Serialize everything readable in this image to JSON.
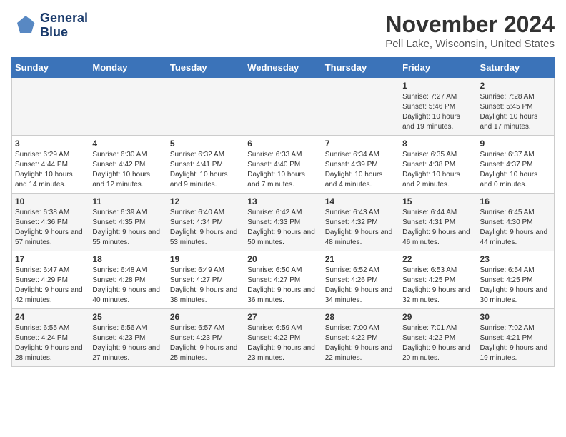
{
  "header": {
    "logo_line1": "General",
    "logo_line2": "Blue",
    "main_title": "November 2024",
    "subtitle": "Pell Lake, Wisconsin, United States"
  },
  "calendar": {
    "days_of_week": [
      "Sunday",
      "Monday",
      "Tuesday",
      "Wednesday",
      "Thursday",
      "Friday",
      "Saturday"
    ],
    "weeks": [
      [
        {
          "day": "",
          "info": ""
        },
        {
          "day": "",
          "info": ""
        },
        {
          "day": "",
          "info": ""
        },
        {
          "day": "",
          "info": ""
        },
        {
          "day": "",
          "info": ""
        },
        {
          "day": "1",
          "info": "Sunrise: 7:27 AM\nSunset: 5:46 PM\nDaylight: 10 hours and 19 minutes."
        },
        {
          "day": "2",
          "info": "Sunrise: 7:28 AM\nSunset: 5:45 PM\nDaylight: 10 hours and 17 minutes."
        }
      ],
      [
        {
          "day": "3",
          "info": "Sunrise: 6:29 AM\nSunset: 4:44 PM\nDaylight: 10 hours and 14 minutes."
        },
        {
          "day": "4",
          "info": "Sunrise: 6:30 AM\nSunset: 4:42 PM\nDaylight: 10 hours and 12 minutes."
        },
        {
          "day": "5",
          "info": "Sunrise: 6:32 AM\nSunset: 4:41 PM\nDaylight: 10 hours and 9 minutes."
        },
        {
          "day": "6",
          "info": "Sunrise: 6:33 AM\nSunset: 4:40 PM\nDaylight: 10 hours and 7 minutes."
        },
        {
          "day": "7",
          "info": "Sunrise: 6:34 AM\nSunset: 4:39 PM\nDaylight: 10 hours and 4 minutes."
        },
        {
          "day": "8",
          "info": "Sunrise: 6:35 AM\nSunset: 4:38 PM\nDaylight: 10 hours and 2 minutes."
        },
        {
          "day": "9",
          "info": "Sunrise: 6:37 AM\nSunset: 4:37 PM\nDaylight: 10 hours and 0 minutes."
        }
      ],
      [
        {
          "day": "10",
          "info": "Sunrise: 6:38 AM\nSunset: 4:36 PM\nDaylight: 9 hours and 57 minutes."
        },
        {
          "day": "11",
          "info": "Sunrise: 6:39 AM\nSunset: 4:35 PM\nDaylight: 9 hours and 55 minutes."
        },
        {
          "day": "12",
          "info": "Sunrise: 6:40 AM\nSunset: 4:34 PM\nDaylight: 9 hours and 53 minutes."
        },
        {
          "day": "13",
          "info": "Sunrise: 6:42 AM\nSunset: 4:33 PM\nDaylight: 9 hours and 50 minutes."
        },
        {
          "day": "14",
          "info": "Sunrise: 6:43 AM\nSunset: 4:32 PM\nDaylight: 9 hours and 48 minutes."
        },
        {
          "day": "15",
          "info": "Sunrise: 6:44 AM\nSunset: 4:31 PM\nDaylight: 9 hours and 46 minutes."
        },
        {
          "day": "16",
          "info": "Sunrise: 6:45 AM\nSunset: 4:30 PM\nDaylight: 9 hours and 44 minutes."
        }
      ],
      [
        {
          "day": "17",
          "info": "Sunrise: 6:47 AM\nSunset: 4:29 PM\nDaylight: 9 hours and 42 minutes."
        },
        {
          "day": "18",
          "info": "Sunrise: 6:48 AM\nSunset: 4:28 PM\nDaylight: 9 hours and 40 minutes."
        },
        {
          "day": "19",
          "info": "Sunrise: 6:49 AM\nSunset: 4:27 PM\nDaylight: 9 hours and 38 minutes."
        },
        {
          "day": "20",
          "info": "Sunrise: 6:50 AM\nSunset: 4:27 PM\nDaylight: 9 hours and 36 minutes."
        },
        {
          "day": "21",
          "info": "Sunrise: 6:52 AM\nSunset: 4:26 PM\nDaylight: 9 hours and 34 minutes."
        },
        {
          "day": "22",
          "info": "Sunrise: 6:53 AM\nSunset: 4:25 PM\nDaylight: 9 hours and 32 minutes."
        },
        {
          "day": "23",
          "info": "Sunrise: 6:54 AM\nSunset: 4:25 PM\nDaylight: 9 hours and 30 minutes."
        }
      ],
      [
        {
          "day": "24",
          "info": "Sunrise: 6:55 AM\nSunset: 4:24 PM\nDaylight: 9 hours and 28 minutes."
        },
        {
          "day": "25",
          "info": "Sunrise: 6:56 AM\nSunset: 4:23 PM\nDaylight: 9 hours and 27 minutes."
        },
        {
          "day": "26",
          "info": "Sunrise: 6:57 AM\nSunset: 4:23 PM\nDaylight: 9 hours and 25 minutes."
        },
        {
          "day": "27",
          "info": "Sunrise: 6:59 AM\nSunset: 4:22 PM\nDaylight: 9 hours and 23 minutes."
        },
        {
          "day": "28",
          "info": "Sunrise: 7:00 AM\nSunset: 4:22 PM\nDaylight: 9 hours and 22 minutes."
        },
        {
          "day": "29",
          "info": "Sunrise: 7:01 AM\nSunset: 4:22 PM\nDaylight: 9 hours and 20 minutes."
        },
        {
          "day": "30",
          "info": "Sunrise: 7:02 AM\nSunset: 4:21 PM\nDaylight: 9 hours and 19 minutes."
        }
      ]
    ]
  }
}
